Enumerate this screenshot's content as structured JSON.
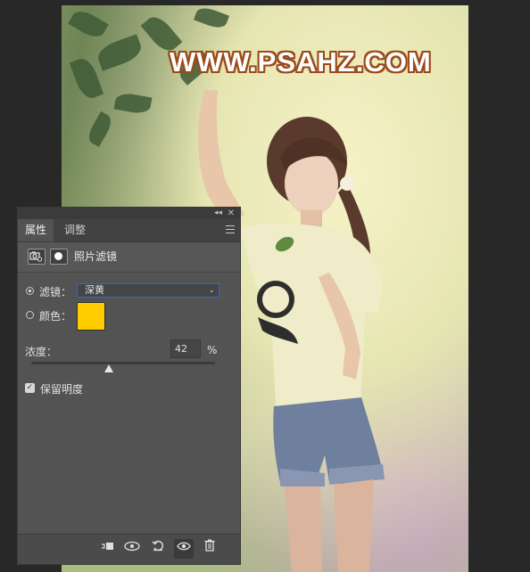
{
  "watermark": "WWW.PSAHZ.COM",
  "panel": {
    "tabs": [
      {
        "label": "属性",
        "active": true
      },
      {
        "label": "调整",
        "active": false
      }
    ],
    "header_label": "照片滤镜",
    "filter": {
      "label": "滤镜：",
      "value": "深黄",
      "checked": true
    },
    "color": {
      "label": "颜色：",
      "value": "#ffcc00",
      "checked": false
    },
    "density": {
      "label": "浓度：",
      "value": "42",
      "unit": "%",
      "slider_fraction": 0.42
    },
    "preserve": {
      "label": "保留明度",
      "checked": true
    },
    "footer_icons": [
      "clip-to-layer-icon",
      "view-previous-state-icon",
      "reset-icon",
      "visibility-icon",
      "delete-icon"
    ]
  }
}
